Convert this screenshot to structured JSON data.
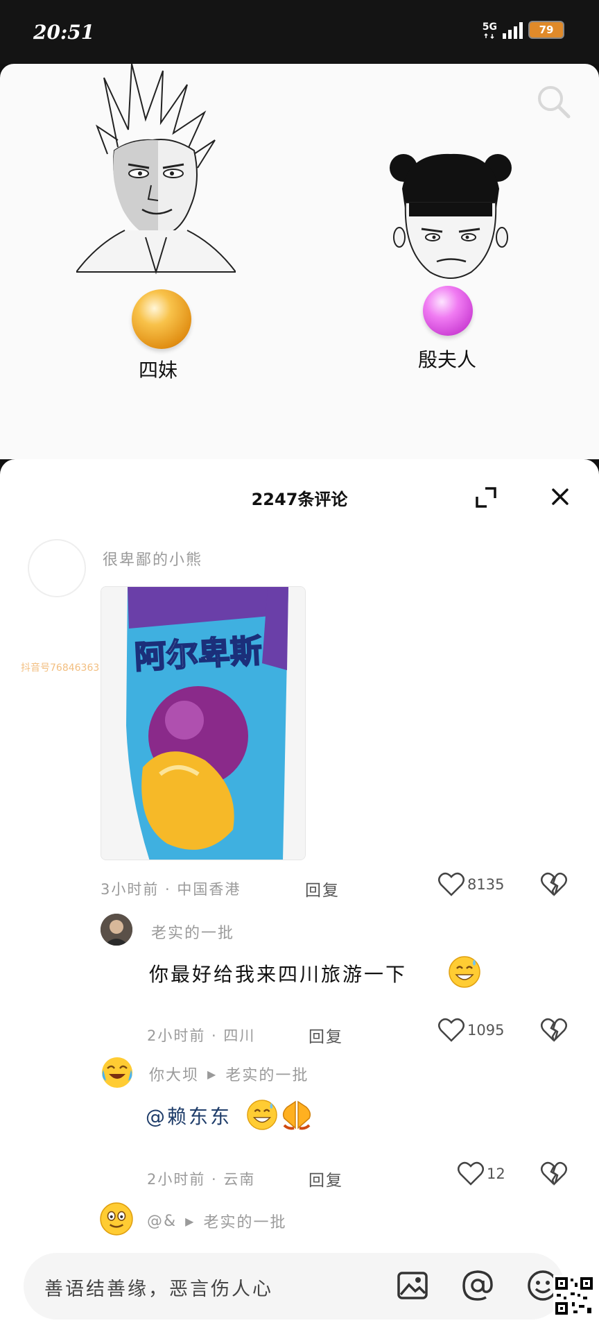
{
  "status_bar": {
    "time": "20:51",
    "network": "5G",
    "battery": "79",
    "signal_bars": 4,
    "battery_color": "#e08a2a"
  },
  "top_area": {
    "search_icon": "search-icon",
    "left_character": {
      "label": "四妹",
      "ball_color": "#f0a020"
    },
    "right_character": {
      "label": "殷夫人",
      "ball_color": "#e060e8"
    }
  },
  "comments_sheet": {
    "title": "2247条评论",
    "expand_icon": "expand-icon",
    "close_icon": "close-icon",
    "watermark": "抖音号76846363",
    "comments": [
      {
        "username": "很卑鄙的小熊",
        "image_text": "阿尔卑斯",
        "time_location": "3小时前 · 中国香港",
        "reply_label": "回复",
        "likes": "8135"
      },
      {
        "username": "老实的一批",
        "text": "你最好给我来四川旅游一下",
        "emoji": "grinning-sweat-emoji",
        "time_location": "2小时前 · 四川",
        "reply_label": "回复",
        "likes": "1095"
      },
      {
        "username": "你大坝",
        "reply_to": "老实的一批",
        "text": "@赖东东",
        "emoji": [
          "grinning-sweat-emoji",
          "pray-emoji"
        ],
        "time_location": "2小时前 · 云南",
        "reply_label": "回复",
        "likes": "12"
      },
      {
        "username": "@&",
        "reply_to": "老实的一批"
      }
    ]
  },
  "input_bar": {
    "placeholder": "善语结善缘，恶言伤人心",
    "image_icon": "image-icon",
    "at_icon": "at-icon",
    "emoji_icon": "emoji-icon"
  }
}
